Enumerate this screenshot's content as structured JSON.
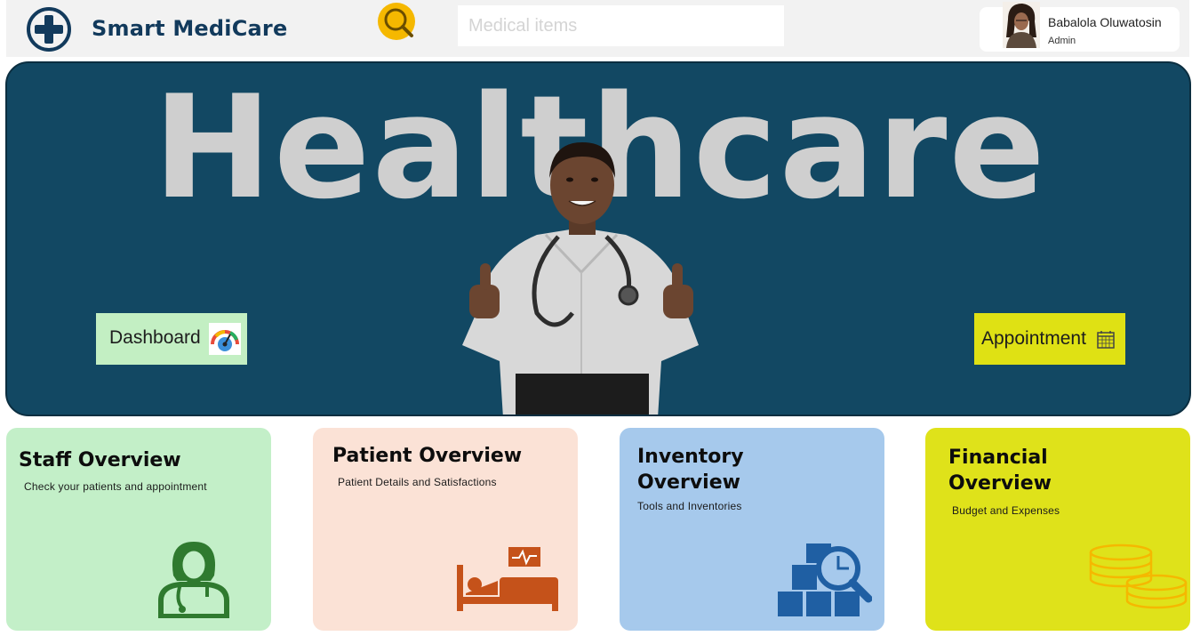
{
  "header": {
    "app_title": "Smart MediCare",
    "search_placeholder": "Medical items",
    "user": {
      "name": "Babalola Oluwatosin",
      "role": "Admin"
    }
  },
  "hero": {
    "title": "Healthcare",
    "dashboard_label": "Dashboard",
    "appointment_label": "Appointment"
  },
  "cards": [
    {
      "title": "Staff Overview",
      "subtitle": "Check your patients and appointment",
      "icon": "nurse-icon",
      "color": "#c3efc8"
    },
    {
      "title": "Patient Overview",
      "subtitle": "Patient Details and Satisfactions",
      "icon": "hospital-bed-icon",
      "color": "#fbe2d6"
    },
    {
      "title": "Inventory Overview",
      "subtitle": "Tools and Inventories",
      "icon": "inventory-search-icon",
      "color": "#a6c9ec"
    },
    {
      "title": "Financial Overview",
      "subtitle": "Budget and Expenses",
      "icon": "coins-icon",
      "color": "#dfe21a"
    }
  ],
  "colors": {
    "brand_navy": "#123a5c",
    "hero_bg": "#124863",
    "search_accent": "#f5b800"
  }
}
